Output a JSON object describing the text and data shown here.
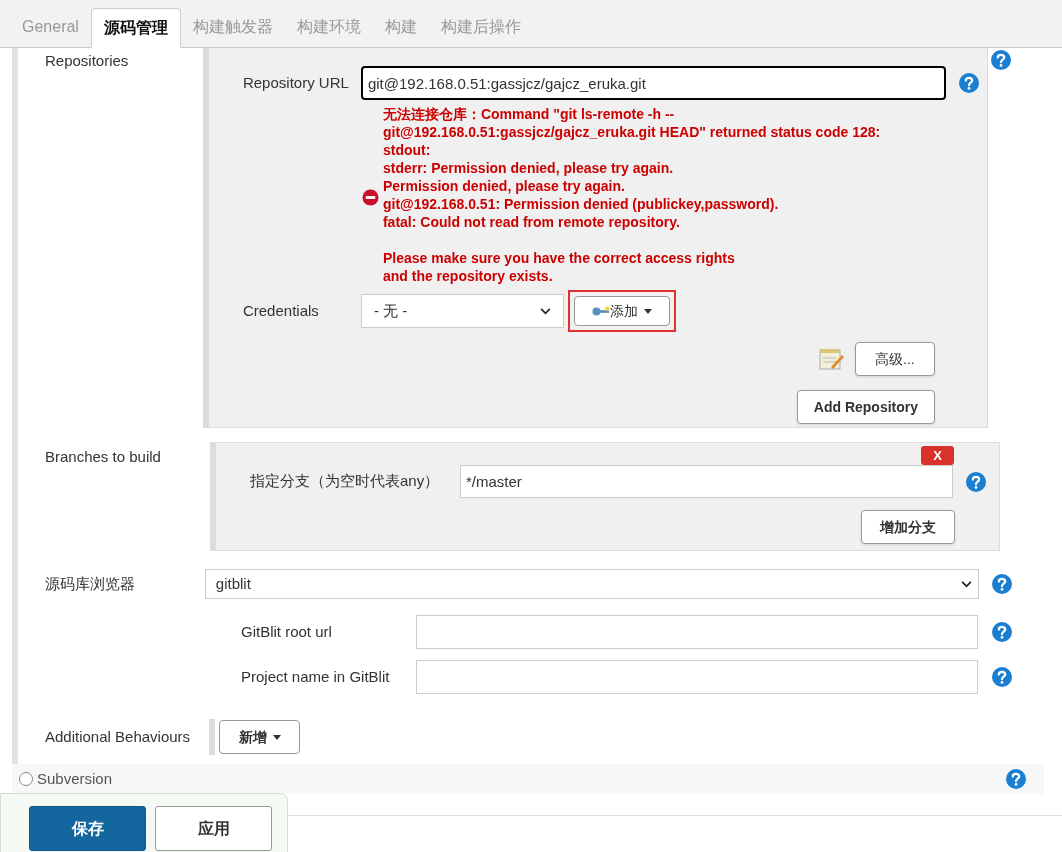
{
  "tabs": [
    {
      "label": "General",
      "selected": false
    },
    {
      "label": "源码管理",
      "selected": true
    },
    {
      "label": "构建触发器",
      "selected": false
    },
    {
      "label": "构建环境",
      "selected": false
    },
    {
      "label": "构建",
      "selected": false
    },
    {
      "label": "构建后操作",
      "selected": false
    }
  ],
  "repositories": {
    "label": "Repositories",
    "url_label": "Repository URL",
    "url_value": "git@192.168.0.51:gassjcz/gajcz_eruka.git",
    "error_paragraphs": [
      [
        "无法连接仓库：Command \"git ls-remote -h --",
        "git@192.168.0.51:gassjcz/gajcz_eruka.git HEAD\" returned status code 128:",
        "stdout:",
        "stderr: Permission denied, please try again.",
        "Permission denied, please try again.",
        "git@192.168.0.51: Permission denied (publickey,password).",
        "fatal: Could not read from remote repository."
      ],
      [
        "Please make sure you have the correct access rights",
        "and the repository exists."
      ]
    ],
    "credentials_label": "Credentials",
    "credentials_value": "- 无 -",
    "add_button": "添加",
    "advanced_button": "高级...",
    "add_repository_button": "Add Repository"
  },
  "branches": {
    "label": "Branches to build",
    "delete_button": "X",
    "spec_label": "指定分支（为空时代表any）",
    "spec_value": "*/master",
    "add_branch_button": "增加分支"
  },
  "browser": {
    "label": "源码库浏览器",
    "value": "gitblit",
    "fields": [
      {
        "label": "GitBlit root url"
      },
      {
        "label": "Project name in GitBlit"
      }
    ]
  },
  "additional_behaviours": {
    "label": "Additional Behaviours",
    "button": "新增"
  },
  "scm_options": [
    {
      "label": "Subversion",
      "selected": false
    }
  ],
  "footer_buttons": [
    {
      "label": "保存",
      "kind": "primary"
    },
    {
      "label": "应用",
      "kind": "secondary"
    }
  ]
}
